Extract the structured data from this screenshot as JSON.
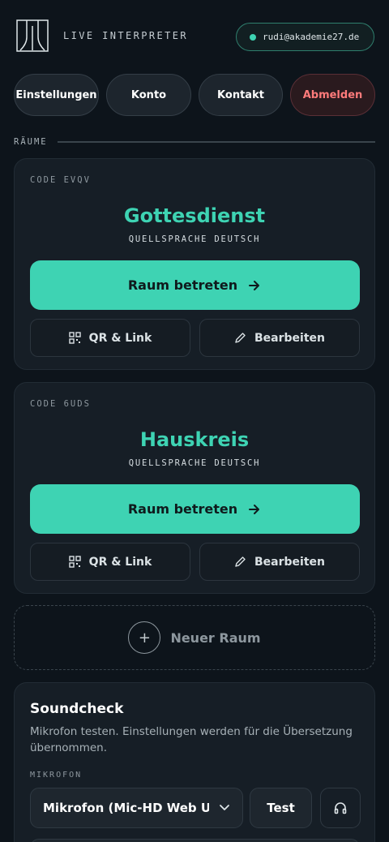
{
  "header": {
    "app_title": "LIVE INTERPRETER",
    "user_email": "rudi@akademie27.de"
  },
  "nav": {
    "settings": "Einstellungen",
    "account": "Konto",
    "contact": "Kontakt",
    "logout": "Abmelden"
  },
  "rooms": {
    "section_label": "RÄUME",
    "items": [
      {
        "code": "CODE EVQV",
        "name": "Gottesdienst",
        "source_language": "QUELLSPRACHE DEUTSCH",
        "enter_label": "Raum betreten",
        "qr_label": "QR & Link",
        "edit_label": "Bearbeiten"
      },
      {
        "code": "CODE 6UDS",
        "name": "Hauskreis",
        "source_language": "QUELLSPRACHE DEUTSCH",
        "enter_label": "Raum betreten",
        "qr_label": "QR & Link",
        "edit_label": "Bearbeiten"
      }
    ],
    "new_room_label": "Neuer Raum"
  },
  "soundcheck": {
    "title": "Soundcheck",
    "description": "Mikrofon testen. Einstellungen werden für die Übersetzung übernommen.",
    "mic_label": "MIKROFON",
    "mic_value": "Mikrofon (Mic-HD Web Ucam)",
    "test_label": "Test"
  },
  "colors": {
    "accent": "#3ed3b3",
    "background": "#0d141b",
    "danger": "#ff7b7b"
  },
  "icons": [
    "logo-icon",
    "status-dot-icon",
    "arrow-right-icon",
    "qr-code-icon",
    "pencil-icon",
    "plus-icon",
    "chevron-down-icon",
    "headphones-icon"
  ]
}
